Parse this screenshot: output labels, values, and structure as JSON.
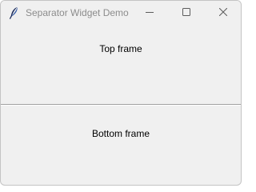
{
  "window": {
    "title": "Separator Widget Demo",
    "app_icon": "feather-icon",
    "controls": {
      "minimize_icon": "minimize-icon",
      "maximize_icon": "maximize-icon",
      "close_icon": "close-icon"
    }
  },
  "top_frame": {
    "label": "Top frame"
  },
  "bottom_frame": {
    "label": "Bottom frame"
  },
  "colors": {
    "background": "#f0f0f0",
    "title_text": "#8c8c8c",
    "separator": "#a0a0a0"
  }
}
